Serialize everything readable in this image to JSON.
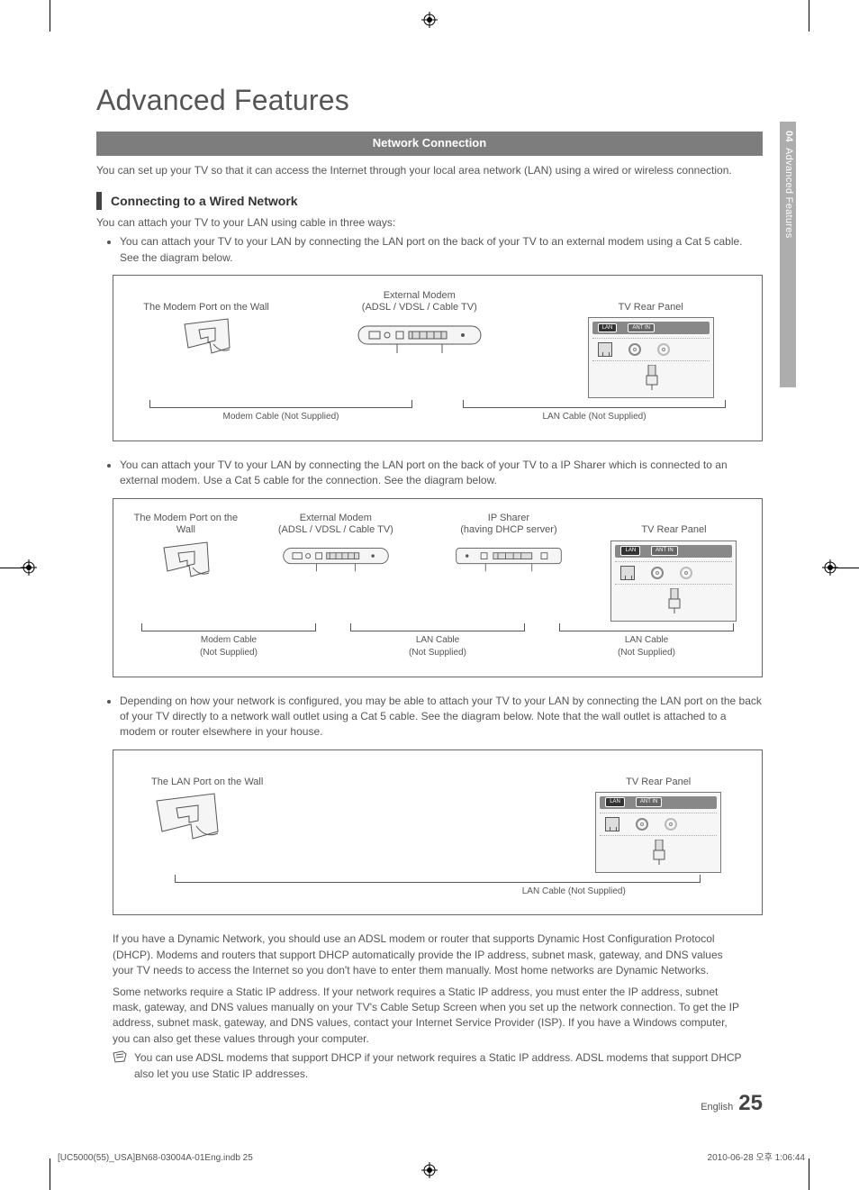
{
  "header": {
    "page_title": "Advanced Features",
    "side_tab_number": "04",
    "side_tab_label": "Advanced Features"
  },
  "section": {
    "bar_title": "Network Connection",
    "intro": "You can set up your TV so that it can access the Internet through your local area network (LAN) using a wired or wireless connection.",
    "subheading": "Connecting to a Wired Network",
    "lead": "You can attach your TV to your LAN using cable in three ways:",
    "bullet1": "You can attach your TV to your LAN by connecting the LAN port on the back of your TV to an external modem using a Cat 5 cable. See the diagram below.",
    "bullet2": "You can attach your TV to your LAN by connecting the LAN port on the back of your TV to a IP Sharer which is connected to an external modem. Use a Cat 5 cable for the connection. See the diagram below.",
    "bullet3": "Depending on how your network is configured, you may be able to attach your TV to your LAN by connecting the LAN port on the back of your TV directly to a network wall outlet using a Cat 5 cable. See the diagram below. Note that the wall outlet is attached to a modem or router elsewhere in your house."
  },
  "diagrams": {
    "d1": {
      "wall_label": "The Modem Port on the Wall",
      "modem_label_line1": "External Modem",
      "modem_label_line2": "(ADSL / VDSL / Cable TV)",
      "tv_label": "TV Rear Panel",
      "cable1": "Modem Cable (Not Supplied)",
      "cable2": "LAN Cable (Not Supplied)"
    },
    "d2": {
      "wall_label": "The Modem Port on the Wall",
      "modem_label_line1": "External Modem",
      "modem_label_line2": "(ADSL / VDSL / Cable TV)",
      "sharer_label_line1": "IP Sharer",
      "sharer_label_line2": "(having DHCP server)",
      "tv_label": "TV Rear Panel",
      "cable1_line1": "Modem Cable",
      "cable1_line2": "(Not Supplied)",
      "cable2_line1": "LAN Cable",
      "cable2_line2": "(Not Supplied)",
      "cable3_line1": "LAN Cable",
      "cable3_line2": "(Not Supplied)"
    },
    "d3": {
      "wall_label": "The LAN Port on the Wall",
      "tv_label": "TV Rear Panel",
      "cable1": "LAN Cable (Not Supplied)"
    },
    "panel": {
      "lan": "LAN",
      "ant": "ANT IN"
    }
  },
  "body": {
    "para1": "If you have a Dynamic Network, you should use an ADSL modem or router that supports Dynamic Host Configuration Protocol (DHCP). Modems and routers that support DHCP automatically provide the IP address, subnet mask, gateway, and DNS values your TV needs to access the Internet so you don't have to enter them manually. Most home networks are Dynamic Networks.",
    "para2": "Some networks require a Static IP address. If your network requires a Static IP address, you must enter the IP address, subnet mask, gateway, and DNS values manually on your TV's Cable Setup Screen when you set up the network connection. To get the IP address, subnet mask, gateway, and DNS values, contact your Internet Service Provider (ISP). If you have a Windows computer, you can also get these values through your computer.",
    "note": "You can use ADSL modems that support DHCP if your network requires a Static IP address. ADSL modems that support DHCP also let you use Static IP addresses."
  },
  "footer": {
    "lang": "English",
    "page_no": "25",
    "file": "[UC5000(55)_USA]BN68-03004A-01Eng.indb   25",
    "timestamp": "2010-06-28   오후 1:06:44"
  }
}
